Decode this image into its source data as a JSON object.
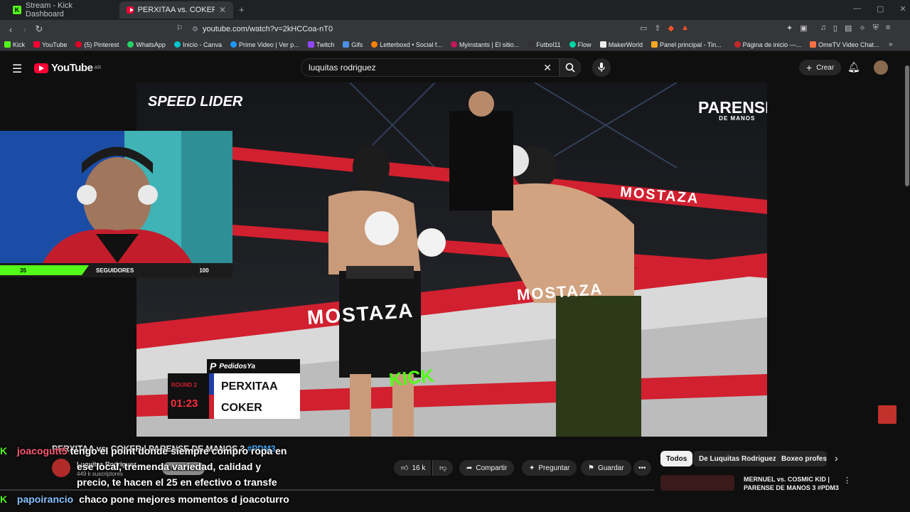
{
  "browser": {
    "tabs": [
      {
        "title": "Stream - Kick Dashboard",
        "active": false
      },
      {
        "title": "PERXITAA vs. COKER | PAREN",
        "active": true
      }
    ],
    "url": "youtube.com/watch?v=2kHCCoa-nT0",
    "bookmarks": [
      "Kick",
      "YouTube",
      "(5) Pinterest",
      "WhatsApp",
      "Inicio - Canva",
      "Prime Video | Ver p...",
      "Twitch",
      "Gifs",
      "Letterboxd • Social f...",
      "Myinstants | El sitio...",
      "Futbol11",
      "Flow",
      "MakerWorld",
      "Panel principal - Tin...",
      "Página de inicio —...",
      "OmeTV Video Chat..."
    ]
  },
  "youtube": {
    "logo": "YouTube",
    "region": "AR",
    "search_value": "luquitas rodriguez",
    "create_label": "Crear"
  },
  "video": {
    "brand_left": "SPEED LIDER",
    "brand_right": "PARENSE",
    "brand_right_sub": "DE MANOS",
    "scorebug": {
      "sponsor": "PedidosYa",
      "round": "ROUND 2",
      "time": "01:23",
      "fighter1": "PERXITAA",
      "fighter2": "COKER"
    },
    "ring_text": "MOSTAZA",
    "ring_text_2": "KICK"
  },
  "webcam": {
    "left_count": "35",
    "label": "SEGUIDORES",
    "right_count": "100"
  },
  "meta": {
    "title": "PERXITAA vs. COKER | PARENSE DE MANOS 3",
    "title_tag": "#PDM3",
    "channel": "Luquitas Rodriguez",
    "subs": "449 k suscriptores",
    "subscribe_label": "Suscribirse",
    "likes": "16 k",
    "share": "Compartir",
    "ask": "Preguntar",
    "save": "Guardar"
  },
  "chips": [
    "Todos",
    "De Luquitas Rodriguez",
    "Boxeo profesio"
  ],
  "recommended": {
    "title_line1": "MERNUEL vs. COSMIC KID |",
    "title_line2": "PARENSE DE MANOS 3 #PDM3"
  },
  "chat": [
    {
      "user": "joacogutt5",
      "msg": "tengo el point donde siempre compro ropa en",
      "cont1": "ese local, tremenda variedad, calidad y",
      "cont2": "precio, te hacen el 25 en efectivo o transfe"
    },
    {
      "user": "papoirancio",
      "msg": "chaco pone mejores momentos d joacoturro"
    }
  ],
  "colors": {
    "kick_green": "#53fc18",
    "youtube_red": "#ff0033",
    "mostaza_red": "#d1202f",
    "chat_user1": "#ff5a72",
    "chat_user2": "#89c4ff"
  }
}
